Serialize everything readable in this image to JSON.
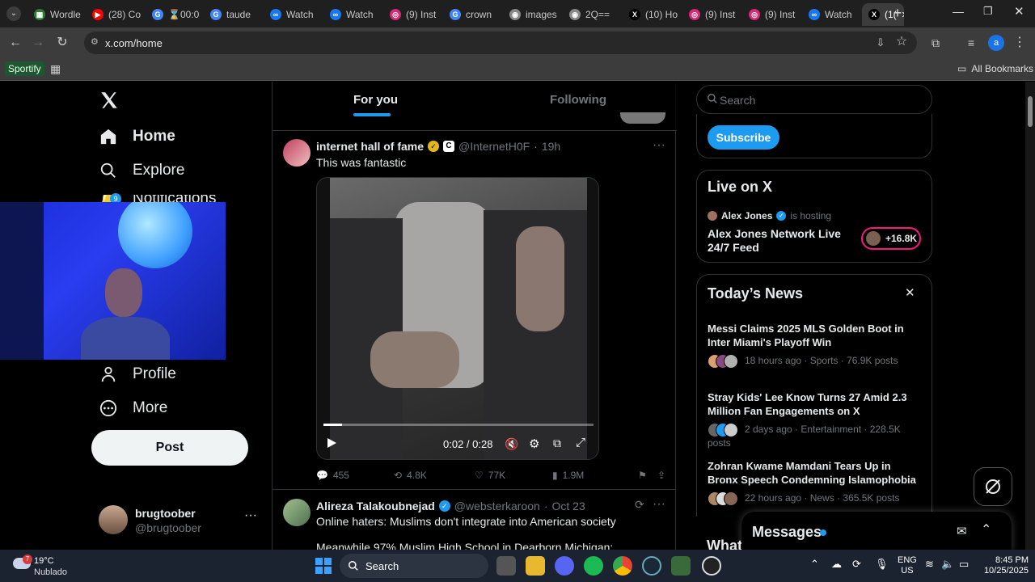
{
  "browser": {
    "tabs": [
      {
        "title": "Wordle",
        "color": "#2e7d32",
        "glyph": "▦"
      },
      {
        "title": "(28) Co",
        "color": "#ff0000",
        "glyph": "▶"
      },
      {
        "title": "⌛00:0",
        "color": "#4285f4",
        "glyph": "G"
      },
      {
        "title": "taude",
        "color": "#4285f4",
        "glyph": "G"
      },
      {
        "title": "Watch",
        "color": "#1877f2",
        "glyph": "∞"
      },
      {
        "title": "Watch",
        "color": "#1877f2",
        "glyph": "∞"
      },
      {
        "title": "(9) Inst",
        "color": "#d62976",
        "glyph": "◎"
      },
      {
        "title": "crown",
        "color": "#4285f4",
        "glyph": "G"
      },
      {
        "title": "images",
        "color": "#888888",
        "glyph": "◉"
      },
      {
        "title": "2Q==",
        "color": "#888888",
        "glyph": "◉"
      },
      {
        "title": "(10) Ho",
        "color": "#000000",
        "glyph": "X"
      },
      {
        "title": "(9) Inst",
        "color": "#d62976",
        "glyph": "◎"
      },
      {
        "title": "(9) Inst",
        "color": "#d62976",
        "glyph": "◎"
      },
      {
        "title": "Watch",
        "color": "#1877f2",
        "glyph": "∞"
      },
      {
        "title": "(1(",
        "color": "#000000",
        "glyph": "X"
      }
    ],
    "url": "x.com/home",
    "bookmark_sportify": "Sportify",
    "all_bookmarks": "All Bookmarks",
    "profile_initial": "a"
  },
  "sidebar": {
    "home": "Home",
    "explore": "Explore",
    "notifications": "Notifications",
    "notif_badge": "9",
    "profile": "Profile",
    "more": "More",
    "post": "Post",
    "user_name": "brugtoober",
    "user_handle": "@brugtoober"
  },
  "feed": {
    "tab_for_you": "For you",
    "tab_following": "Following",
    "post1": {
      "author": "internet hall of fame",
      "badge": "C",
      "handle": "@InternetH0F",
      "time": "19h",
      "text": "This was fantastic",
      "video_time": "0:02 / 0:28",
      "progress": 0.07,
      "replies": "455",
      "reposts": "4.8K",
      "likes": "77K",
      "views": "1.9M"
    },
    "post2": {
      "author": "Alireza Talakoubnejad",
      "handle": "@websterkaroon",
      "time": "Oct 23",
      "line1": "Online haters: Muslims don't integrate into American society",
      "line2": "Meanwhile 97% Muslim High School in Dearborn Michigan:"
    }
  },
  "right": {
    "search_placeholder": "Search",
    "subscribe": "Subscribe",
    "live_heading": "Live on X",
    "live_host": "Alex Jones",
    "live_hosting": "is hosting",
    "live_title": "Alex Jones Network Live 24/7 Feed",
    "live_count": "+16.8K",
    "news_heading": "Today’s News",
    "news": [
      {
        "title": "Messi Claims 2025 MLS Golden Boot in Inter Miami's Playoff Win",
        "meta": "18 hours ago · Sports · 76.9K posts"
      },
      {
        "title": "Stray Kids' Lee Know Turns 27 Amid 2.3 Million Fan Engagements on X",
        "meta": "2 days ago · Entertainment · 228.5K posts"
      },
      {
        "title": "Zohran Kwame Mamdani Tears Up in Bronx Speech Condemning Islamophobia",
        "meta": "22 hours ago · News · 365.5K posts"
      }
    ],
    "whats": "What",
    "messages": "Messages"
  },
  "taskbar": {
    "weather_temp": "19°C",
    "weather_desc": "Nublado",
    "weather_badge": "7",
    "search": "Search",
    "lang1": "ENG",
    "lang2": "US",
    "time": "8:45 PM",
    "date": "10/25/2025"
  }
}
